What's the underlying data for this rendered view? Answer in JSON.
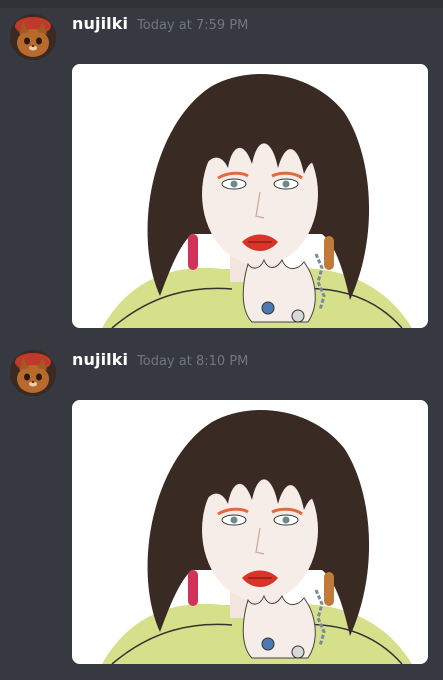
{
  "messages": [
    {
      "username": "nujilki",
      "timestamp": "Today at 7:59 PM",
      "attachment": "illustration-image"
    },
    {
      "username": "nujilki",
      "timestamp": "Today at 8:10 PM",
      "attachment": "illustration-image"
    }
  ],
  "colors": {
    "background": "#36393f",
    "topbar": "#2f3136",
    "username": "#ffffff",
    "timestamp": "#72767d",
    "attachment_bg": "#ffffff"
  },
  "icons": {
    "avatar": "cat-avatar-icon"
  }
}
